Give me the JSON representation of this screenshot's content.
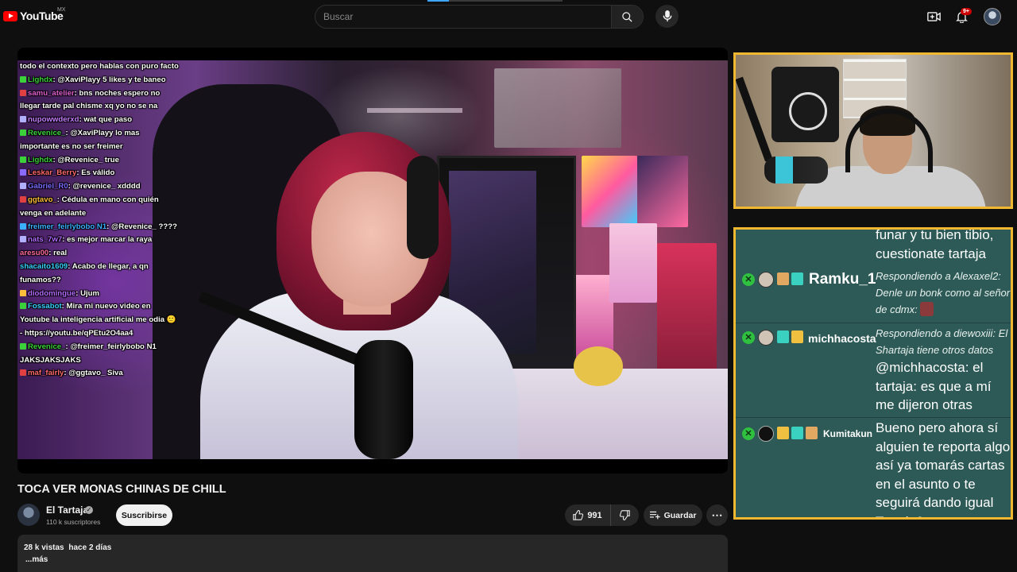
{
  "header": {
    "logo_text": "YouTube",
    "country": "MX",
    "search_placeholder": "Buscar",
    "notification_badge": "9+"
  },
  "player": {
    "chat_overlay": [
      {
        "text": "todo el contexto pero hablas con puro facto",
        "color": "#ffffff",
        "icon_color": ""
      },
      {
        "user": "Lighdx",
        "text": ": @XaviPlayy 5 likes y te baneo",
        "color": "#3ad13a",
        "icon_color": "#3ad13a"
      },
      {
        "user": "samu_atelier",
        "text": ": bns noches espero no llegar tarde pal chisme xq yo no se na",
        "color": "#e05fd0",
        "icon_color": "#e04040"
      },
      {
        "user": "nupowwderxd",
        "text": ": wat que paso",
        "color": "#c77dff",
        "icon_color": "#b0b0ff"
      },
      {
        "user": "Revenice_",
        "text": ": @XaviPlayy lo mas importante es no ser freimer",
        "color": "#3ad13a",
        "icon_color": "#3ad13a"
      },
      {
        "user": "Lighdx",
        "text": ": @Revenice_ true",
        "color": "#3ad13a",
        "icon_color": "#3ad13a"
      },
      {
        "user": "Leskar_Berry",
        "text": ": Es válido",
        "color": "#ff6a6a",
        "icon_color": "#8a6aff"
      },
      {
        "user": "Gabriel_R0",
        "text": ": @revenice_ xdddd",
        "color": "#7a6aff",
        "icon_color": "#b0b0ff"
      },
      {
        "user": "ggtavo_",
        "text": ": Cédula en mano con quién venga en adelante",
        "color": "#ffbf3a",
        "icon_color": "#e04040"
      },
      {
        "user": "freimer_feirlybobo N1",
        "text": ": @Revenice_ ????",
        "color": "#3ab0ff",
        "icon_color": "#3ab0ff"
      },
      {
        "user": "nats_7w7",
        "text": ": es mejor marcar la raya",
        "color": "#b46aff",
        "icon_color": "#b0b0ff"
      },
      {
        "user": "aresu00",
        "text": ": real",
        "color": "#ff6aa0",
        "icon_color": ""
      },
      {
        "user": "shacaito1609",
        "text": ": Acabo de llegar, a qn funamos??",
        "color": "#3ad1ff",
        "icon_color": ""
      },
      {
        "user": "diodomingue",
        "text": ": Ujum",
        "color": "#b46aff",
        "icon_color": "#ffbf3a"
      },
      {
        "user": "Fossabot",
        "text": ": Mira mi nuevo video en Youtube la inteligencia artificial me odia 🙂 - https://youtu.be/qPEtu2O4aa4",
        "color": "#3ad1ff",
        "icon_color": "#3ad13a"
      },
      {
        "user": "Revenice_",
        "text": ": @freimer_feirlybobo N1 JAKSJAKSJAKS",
        "color": "#3ad13a",
        "icon_color": "#3ad13a"
      },
      {
        "user": "maf_fairly",
        "text": ": @ggtavo_ Siva",
        "color": "#ff6a6a",
        "icon_color": "#e04040"
      }
    ]
  },
  "video": {
    "title": "TOCA VER MONAS CHINAS DE CHILL",
    "channel_name": "El Tartaja",
    "subscribers": "110 k suscriptores",
    "subscribe_label": "Suscribirse",
    "likes": "991",
    "save_label": "Guardar",
    "views": "28 k vistas",
    "time_ago": "hace 2 días",
    "more_label": "...más"
  },
  "stream_chat": [
    {
      "user": "",
      "reply": "",
      "body": "funar y tu bien tibio, cuestionate tartaja"
    },
    {
      "user": "Ramku_1",
      "reply": "Respondiendo a Alexaxel2: Denle un bonk como al señor de cdmx:",
      "body": ""
    },
    {
      "user": "michhacosta",
      "reply": "Respondiendo a diewoxiii: El Shartaja tiene otros datos",
      "body": "@michhacosta: el tartaja: es que a mí me dijeron otras cosas"
    },
    {
      "user": "Kumitakun",
      "reply": "",
      "body": "Bueno pero ahora sí alguien te reporta algo así ya tomarás cartas en el asunto o te seguirá dando igual Tartaja?"
    }
  ],
  "colors": {
    "frame": "#f0b830",
    "chat_bg": "#2d5a56",
    "badge_green": "#30c040"
  }
}
